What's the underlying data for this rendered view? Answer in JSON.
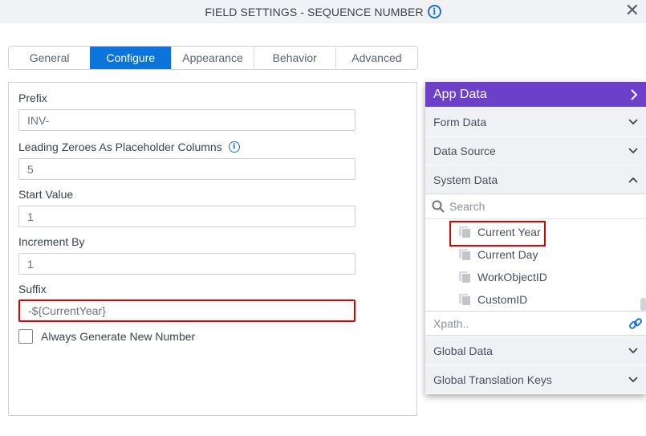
{
  "dialog": {
    "title": "FIELD SETTINGS - SEQUENCE NUMBER",
    "info_icon": "info-icon",
    "close_icon": "close-icon",
    "close_glyph": "✕"
  },
  "tabs": [
    {
      "label": "General",
      "active": false
    },
    {
      "label": "Configure",
      "active": true
    },
    {
      "label": "Appearance",
      "active": false
    },
    {
      "label": "Behavior",
      "active": false
    },
    {
      "label": "Advanced",
      "active": false
    }
  ],
  "form": {
    "prefix": {
      "label": "Prefix",
      "value": "INV-"
    },
    "leading_zeroes": {
      "label": "Leading Zeroes As Placeholder Columns",
      "value": "5",
      "info_icon": "info-icon"
    },
    "start_value": {
      "label": "Start Value",
      "value": "1"
    },
    "increment_by": {
      "label": "Increment By",
      "value": "1"
    },
    "suffix": {
      "label": "Suffix",
      "value": "-${CurrentYear}"
    },
    "always_generate": {
      "label": "Always Generate New Number",
      "checked": false
    }
  },
  "app_data": {
    "title": "App Data",
    "header_icon": "chevron-right-icon",
    "sections_top": [
      {
        "label": "Form Data",
        "expanded": false
      },
      {
        "label": "Data Source",
        "expanded": false
      },
      {
        "label": "System Data",
        "expanded": true
      }
    ],
    "search_placeholder": "Search",
    "system_items": [
      {
        "label": "Current Year",
        "highlighted": true
      },
      {
        "label": "Current Day",
        "highlighted": false
      },
      {
        "label": "WorkObjectID",
        "highlighted": false
      },
      {
        "label": "CustomID",
        "highlighted": false
      }
    ],
    "xpath_placeholder": "Xpath..",
    "xpath_icon": "link-icon",
    "sections_bottom": [
      {
        "label": "Global Data",
        "expanded": false
      },
      {
        "label": "Global Translation Keys",
        "expanded": false
      }
    ]
  },
  "colors": {
    "accent_blue": "#0a74da",
    "app_data_purple": "#6c40c9",
    "highlight_red": "#e00000"
  }
}
